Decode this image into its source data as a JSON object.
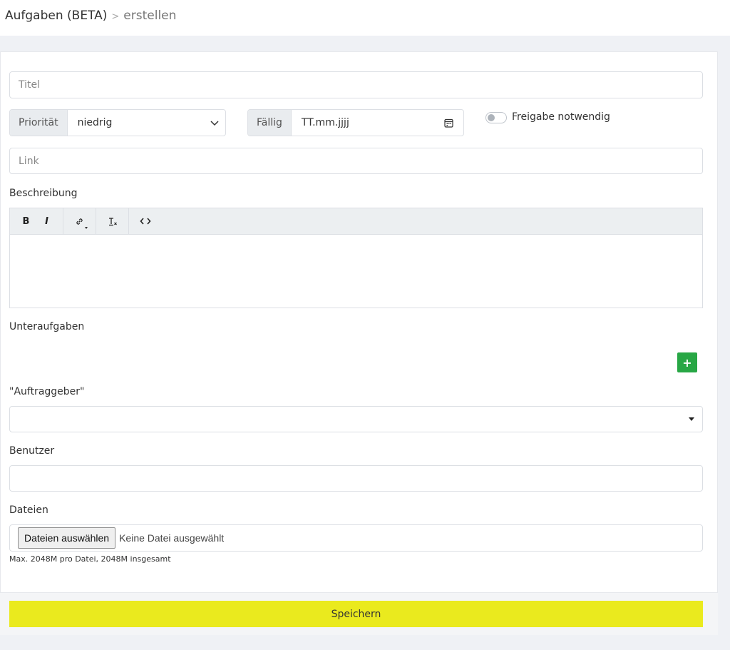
{
  "breadcrumb": {
    "root": "Aufgaben (BETA)",
    "separator": ">",
    "current": "erstellen"
  },
  "form": {
    "title_placeholder": "Titel",
    "priority": {
      "label": "Priorität",
      "value": "niedrig"
    },
    "due": {
      "label": "Fällig",
      "placeholder": "TT.mm.jjjj"
    },
    "approval_toggle": {
      "label": "Freigabe notwendig",
      "checked": false
    },
    "link_placeholder": "Link",
    "description_label": "Beschreibung",
    "editor_toolbar": [
      "B",
      "I",
      "link",
      "clear-format",
      "code"
    ],
    "subtasks_label": "Unteraufgaben",
    "add_subtask_icon": "+",
    "client_label": "\"Auftraggeber\"",
    "user_label": "Benutzer",
    "files_label": "Dateien",
    "file_button": "Dateien auswählen",
    "file_status": "Keine Datei ausgewählt",
    "file_hint": "Max. 2048M pro Datei, 2048M insgesamt",
    "save_label": "Speichern"
  },
  "colors": {
    "save": "#eaea1e",
    "add": "#28a745"
  }
}
